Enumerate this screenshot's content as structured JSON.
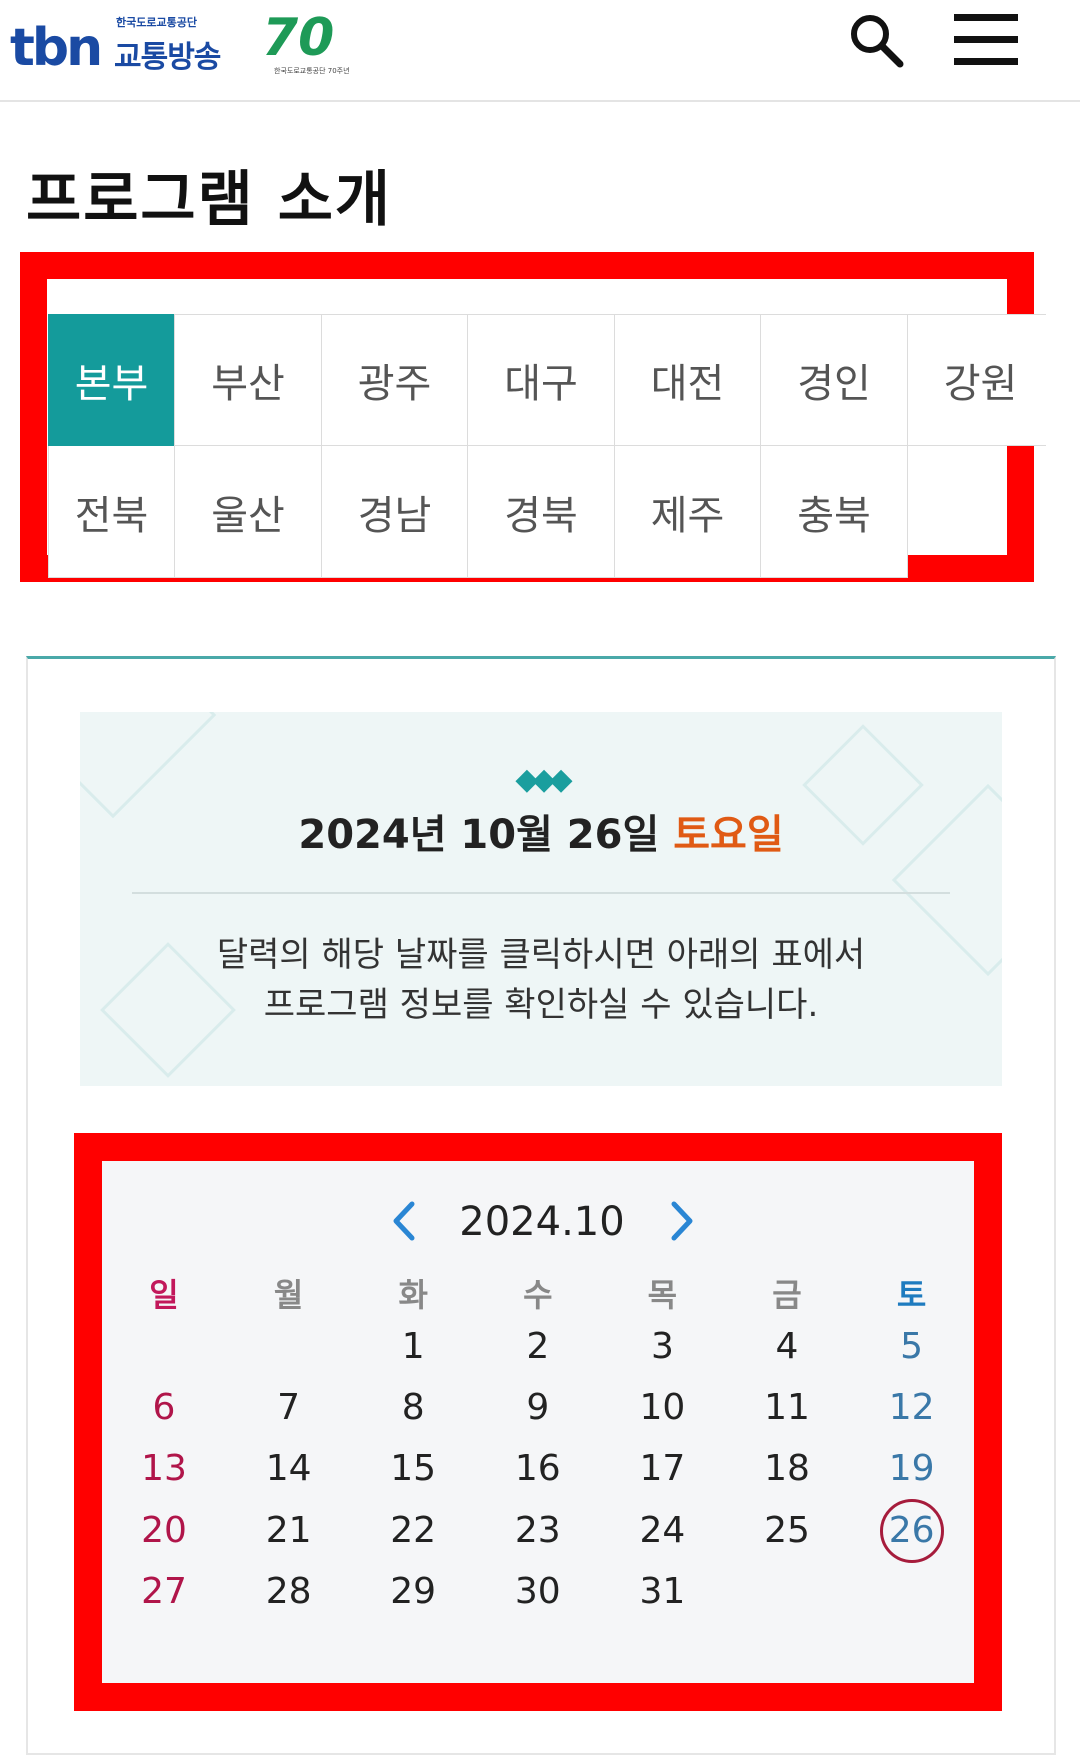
{
  "header": {
    "logo_main": "tbn",
    "logo_sub": "한국도로교통공단",
    "logo_name": "교통방송",
    "anniversary_number": "70",
    "anniversary_caption": "한국도로교통공단 70주년",
    "search_icon": "search-icon",
    "menu_icon": "hamburger-menu-icon"
  },
  "page_title": "프로그램 소개",
  "regions": {
    "row1": [
      "본부",
      "부산",
      "광주",
      "대구",
      "대전",
      "경인",
      "강원"
    ],
    "row2": [
      "전북",
      "울산",
      "경남",
      "경북",
      "제주",
      "충북"
    ],
    "active": "본부"
  },
  "date_banner": {
    "diamonds": "◆◆◆",
    "date_text": "2024년 10월 26일",
    "weekday": "토요일",
    "line1": "달력의 해당 날짜를 클릭하시면 아래의 표에서",
    "line2": "프로그램 정보를 확인하실 수 있습니다."
  },
  "calendar": {
    "month_label": "2024.10",
    "weekdays": [
      "일",
      "월",
      "화",
      "수",
      "목",
      "금",
      "토"
    ],
    "weeks": [
      [
        "",
        "",
        "1",
        "2",
        "3",
        "4",
        "5"
      ],
      [
        "6",
        "7",
        "8",
        "9",
        "10",
        "11",
        "12"
      ],
      [
        "13",
        "14",
        "15",
        "16",
        "17",
        "18",
        "19"
      ],
      [
        "20",
        "21",
        "22",
        "23",
        "24",
        "25",
        "26"
      ],
      [
        "27",
        "28",
        "29",
        "30",
        "31",
        "",
        ""
      ]
    ],
    "selected_day": "26"
  },
  "colors": {
    "accent_teal": "#149b9b",
    "highlight_red": "#ff0000",
    "weekday_orange": "#e05a14",
    "sunday": "#b0154a",
    "saturday": "#3a78a8"
  }
}
